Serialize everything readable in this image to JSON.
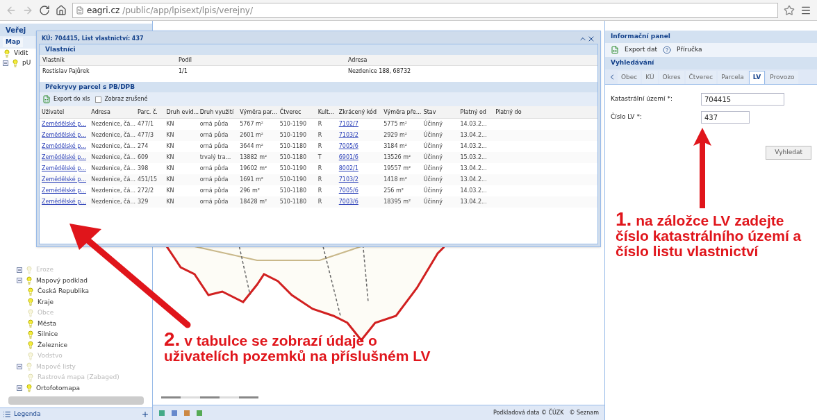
{
  "browser": {
    "url_host": "eagri.cz",
    "url_path": "/public/app/lpisext/lpis/verejny/"
  },
  "left_panel": {
    "title": "Veřej",
    "tab": "Map",
    "top_items": [
      {
        "label": "Vidit",
        "on": true,
        "expandable": false
      },
      {
        "label": "pU",
        "on": true,
        "expandable": true
      }
    ],
    "tree": [
      {
        "label": "Eroze",
        "on": false
      },
      {
        "label": "Mapový podklad",
        "on": true,
        "children": [
          {
            "label": "Česká Republika",
            "on": true
          },
          {
            "label": "Kraje",
            "on": true
          },
          {
            "label": "Obce",
            "on": false
          },
          {
            "label": "Města",
            "on": true
          },
          {
            "label": "Silnice",
            "on": true
          },
          {
            "label": "Železnice",
            "on": true
          },
          {
            "label": "Vodstvo",
            "on": false
          }
        ]
      },
      {
        "label": "Mapové listy",
        "on": false,
        "children": [
          {
            "label": "Rastrová mapa (Zabaged)",
            "on": false
          }
        ]
      },
      {
        "label": "Ortofotomapa",
        "on": true
      }
    ],
    "footer": "Legenda"
  },
  "map": {
    "attribution": "Podkladová data © ČÚZK",
    "attribution_2": "© Seznam"
  },
  "window": {
    "title": "KÚ: 704415, List vlastnictví: 437",
    "owners": {
      "title": "Vlastníci",
      "columns": [
        "Vlastník",
        "Podíl",
        "Adresa"
      ],
      "rows": [
        [
          "Rostislav Pajůrek",
          "1/1",
          "Nezdenice 188, 68732"
        ]
      ]
    },
    "overlaps": {
      "title": "Překryvy parcel s PB/DPB",
      "export": "Export do xls",
      "show_cancelled": {
        "label": "Zobraz zrušené",
        "checked": false
      },
      "columns": [
        "Uživatel",
        "Adresa",
        "Parc. č.",
        "Druh evid...",
        "Druh využití",
        "Výměra par...",
        "Čtverec",
        "Kult...",
        "Zkrácený kód",
        "Výměra pře...",
        "Stav",
        "Platný od",
        "Platný do"
      ],
      "rows": [
        [
          "Zemědělské p...",
          "Nezdenice, čá...",
          "477/1",
          "KN",
          "orná půda",
          "5767 m²",
          "510-1190",
          "R",
          "7102/7",
          "5775 m²",
          "Účinný",
          "14.03.2...",
          ""
        ],
        [
          "Zemědělské p...",
          "Nezdenice, čá...",
          "477/3",
          "KN",
          "orná půda",
          "2601 m²",
          "510-1190",
          "R",
          "7103/2",
          "2929 m²",
          "Účinný",
          "13.04.2...",
          ""
        ],
        [
          "Zemědělské p...",
          "Nezdenice, čá...",
          "274",
          "KN",
          "orná půda",
          "3644 m²",
          "510-1180",
          "R",
          "7005/6",
          "3184 m²",
          "Účinný",
          "14.03.2...",
          ""
        ],
        [
          "Zemědělské p...",
          "Nezdenice, čá...",
          "609",
          "KN",
          "trvalý tra...",
          "13882 m²",
          "510-1180",
          "T",
          "6901/6",
          "13526 m²",
          "Účinný",
          "15.03.2...",
          ""
        ],
        [
          "Zemědělské p...",
          "Nezdenice, čá...",
          "398",
          "KN",
          "orná půda",
          "19602 m²",
          "510-1190",
          "R",
          "8002/1",
          "19557 m²",
          "Účinný",
          "13.04.2...",
          ""
        ],
        [
          "Zemědělské p...",
          "Nezdenice, čá...",
          "451/15",
          "KN",
          "orná půda",
          "1691 m²",
          "510-1190",
          "R",
          "7103/2",
          "1418 m²",
          "Účinný",
          "13.04.2...",
          ""
        ],
        [
          "Zemědělské p...",
          "Nezdenice, čá...",
          "272/2",
          "KN",
          "orná půda",
          "296 m²",
          "510-1180",
          "R",
          "7005/6",
          "256 m²",
          "Účinný",
          "14.03.2...",
          ""
        ],
        [
          "Zemědělské p...",
          "Nezdenice, čá...",
          "329",
          "KN",
          "orná půda",
          "18428 m²",
          "510-1180",
          "R",
          "7003/6",
          "18395 m²",
          "Účinný",
          "13.04.2...",
          ""
        ]
      ]
    }
  },
  "right_panel": {
    "title": "Informační panel",
    "tools": [
      "Export dat",
      "Příručka"
    ],
    "search_title": "Vyhledávání",
    "tabs": [
      {
        "label": "Obec",
        "selected": false
      },
      {
        "label": "KÚ",
        "selected": false
      },
      {
        "label": "Okres",
        "selected": false
      },
      {
        "label": "Čtverec",
        "selected": false
      },
      {
        "label": "Parcela",
        "selected": false
      },
      {
        "label": "LV",
        "selected": true
      },
      {
        "label": "Provozo",
        "selected": false
      }
    ],
    "fields": [
      {
        "label": "Katastrální území *:",
        "value": "704415"
      },
      {
        "label": "Číslo LV *:",
        "value": "437"
      }
    ],
    "button": "Vyhledat"
  },
  "annotations": [
    {
      "number": "1.",
      "text": "na záložce LV zadejte číslo katastrálního území a číslo listu vlastnictví"
    },
    {
      "number": "2.",
      "text": "v tabulce se zobrazí údaje o uživatelích pozemků na příslušném LV"
    }
  ]
}
